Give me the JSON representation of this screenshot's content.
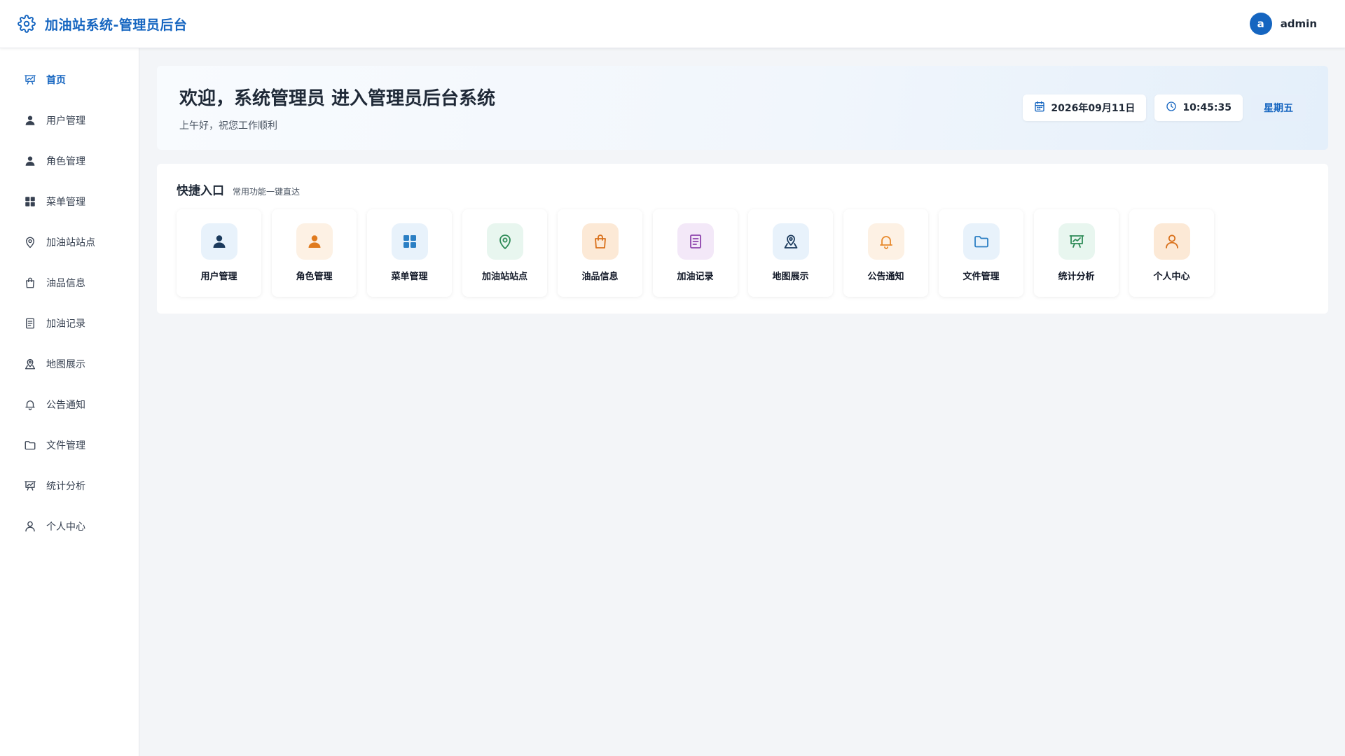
{
  "header": {
    "title": "加油站系统-管理员后台",
    "brand_icon": "gear-icon",
    "avatar_letter": "a",
    "username": "admin"
  },
  "sidebar": {
    "items": [
      {
        "label": "首页",
        "icon": "chart-board-icon",
        "active": true
      },
      {
        "label": "用户管理",
        "icon": "user-filled-icon"
      },
      {
        "label": "角色管理",
        "icon": "user-filled-icon"
      },
      {
        "label": "菜单管理",
        "icon": "grid-icon"
      },
      {
        "label": "加油站站点",
        "icon": "location-pin-icon"
      },
      {
        "label": "油品信息",
        "icon": "shopping-bag-icon"
      },
      {
        "label": "加油记录",
        "icon": "document-icon"
      },
      {
        "label": "地图展示",
        "icon": "map-location-icon"
      },
      {
        "label": "公告通知",
        "icon": "bell-icon"
      },
      {
        "label": "文件管理",
        "icon": "folder-icon"
      },
      {
        "label": "统计分析",
        "icon": "chart-board-icon"
      },
      {
        "label": "个人中心",
        "icon": "user-outline-icon"
      }
    ]
  },
  "welcome": {
    "title": "欢迎，系统管理员 进入管理员后台系统",
    "subtitle": "上午好，祝您工作顺利",
    "date": "2026年09月11日",
    "time": "10:45:35",
    "weekday": "星期五"
  },
  "quick": {
    "title": "快捷入口",
    "subtitle": "常用功能一键直达",
    "items": [
      {
        "label": "用户管理",
        "icon": "user-filled-icon",
        "color": "#1b3a5c",
        "bg": "#e8f2fb"
      },
      {
        "label": "角色管理",
        "icon": "user-filled-icon",
        "color": "#e07b1f",
        "bg": "#fdf1e4"
      },
      {
        "label": "菜单管理",
        "icon": "grid-icon",
        "color": "#2b7fc4",
        "bg": "#e8f2fb"
      },
      {
        "label": "加油站站点",
        "icon": "location-pin-icon",
        "color": "#2e8b57",
        "bg": "#e8f6ef"
      },
      {
        "label": "油品信息",
        "icon": "shopping-bag-icon",
        "color": "#d9701a",
        "bg": "#fce9d6"
      },
      {
        "label": "加油记录",
        "icon": "document-icon",
        "color": "#8e44ad",
        "bg": "#f3e8f8"
      },
      {
        "label": "地图展示",
        "icon": "map-location-icon",
        "color": "#1b3a5c",
        "bg": "#e8f2fb"
      },
      {
        "label": "公告通知",
        "icon": "bell-icon",
        "color": "#e8892b",
        "bg": "#fdf1e4"
      },
      {
        "label": "文件管理",
        "icon": "folder-icon",
        "color": "#2b7fc4",
        "bg": "#e8f2fb"
      },
      {
        "label": "统计分析",
        "icon": "chart-board-icon",
        "color": "#2e8b57",
        "bg": "#e8f6ef"
      },
      {
        "label": "个人中心",
        "icon": "user-outline-icon",
        "color": "#d9701a",
        "bg": "#fce9d6"
      }
    ]
  },
  "colors": {
    "accent": "#1565c0",
    "sidebar_icon": "#374151"
  }
}
